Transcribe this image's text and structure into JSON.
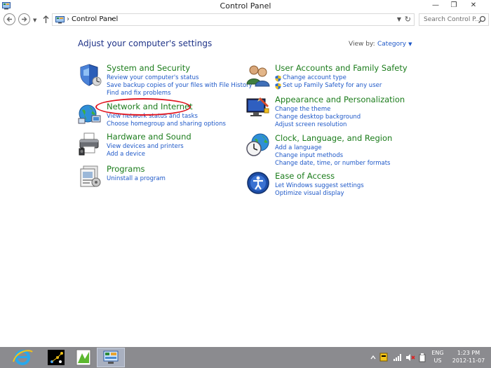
{
  "window": {
    "title": "Control Panel",
    "min_glyph": "—",
    "max_glyph": "❐",
    "close_glyph": "✕"
  },
  "nav": {
    "back_icon": "back-arrow-icon",
    "forward_icon": "forward-arrow-icon",
    "recent_icon": "chevron-down-icon",
    "up_icon": "up-arrow-icon",
    "breadcrumb": [
      "Control Panel"
    ],
    "search_placeholder": "Search Control P..."
  },
  "main": {
    "heading": "Adjust your computer's settings",
    "view_by_label": "View by:",
    "view_by_value": "Category",
    "left_categories": [
      {
        "title": "System and Security",
        "icon": "shield-icon",
        "links": [
          "Review your computer's status",
          "Save backup copies of your files with File History",
          "Find and fix problems"
        ]
      },
      {
        "title": "Network and Internet",
        "icon": "globe-network-icon",
        "links": [
          "View network status and tasks",
          "Choose homegroup and sharing options"
        ]
      },
      {
        "title": "Hardware and Sound",
        "icon": "printer-icon",
        "links": [
          "View devices and printers",
          "Add a device"
        ]
      },
      {
        "title": "Programs",
        "icon": "programs-icon",
        "links": [
          "Uninstall a program"
        ]
      }
    ],
    "right_categories": [
      {
        "title": "User Accounts and Family Safety",
        "icon": "users-icon",
        "links": [
          "Change account type",
          "Set up Family Safety for any user"
        ]
      },
      {
        "title": "Appearance and Personalization",
        "icon": "appearance-icon",
        "links": [
          "Change the theme",
          "Change desktop background",
          "Adjust screen resolution"
        ]
      },
      {
        "title": "Clock, Language, and Region",
        "icon": "clock-globe-icon",
        "links": [
          "Add a language",
          "Change input methods",
          "Change date, time, or number formats"
        ]
      },
      {
        "title": "Ease of Access",
        "icon": "ease-of-access-icon",
        "links": [
          "Let Windows suggest settings",
          "Optimize visual display"
        ]
      }
    ],
    "annotation_color": "#e0141e"
  },
  "taskbar": {
    "items": [
      "internet-explorer-icon",
      "game-icon",
      "green-app-icon",
      "control-panel-icon"
    ],
    "language_top": "ENG",
    "language_bottom": "US",
    "time": "1:23 PM",
    "date": "2012-11-07"
  },
  "colors": {
    "category_title": "#1b7c1b",
    "link": "#1e58c8",
    "heading": "#1e3287",
    "taskbar": "#8b8b8f"
  }
}
